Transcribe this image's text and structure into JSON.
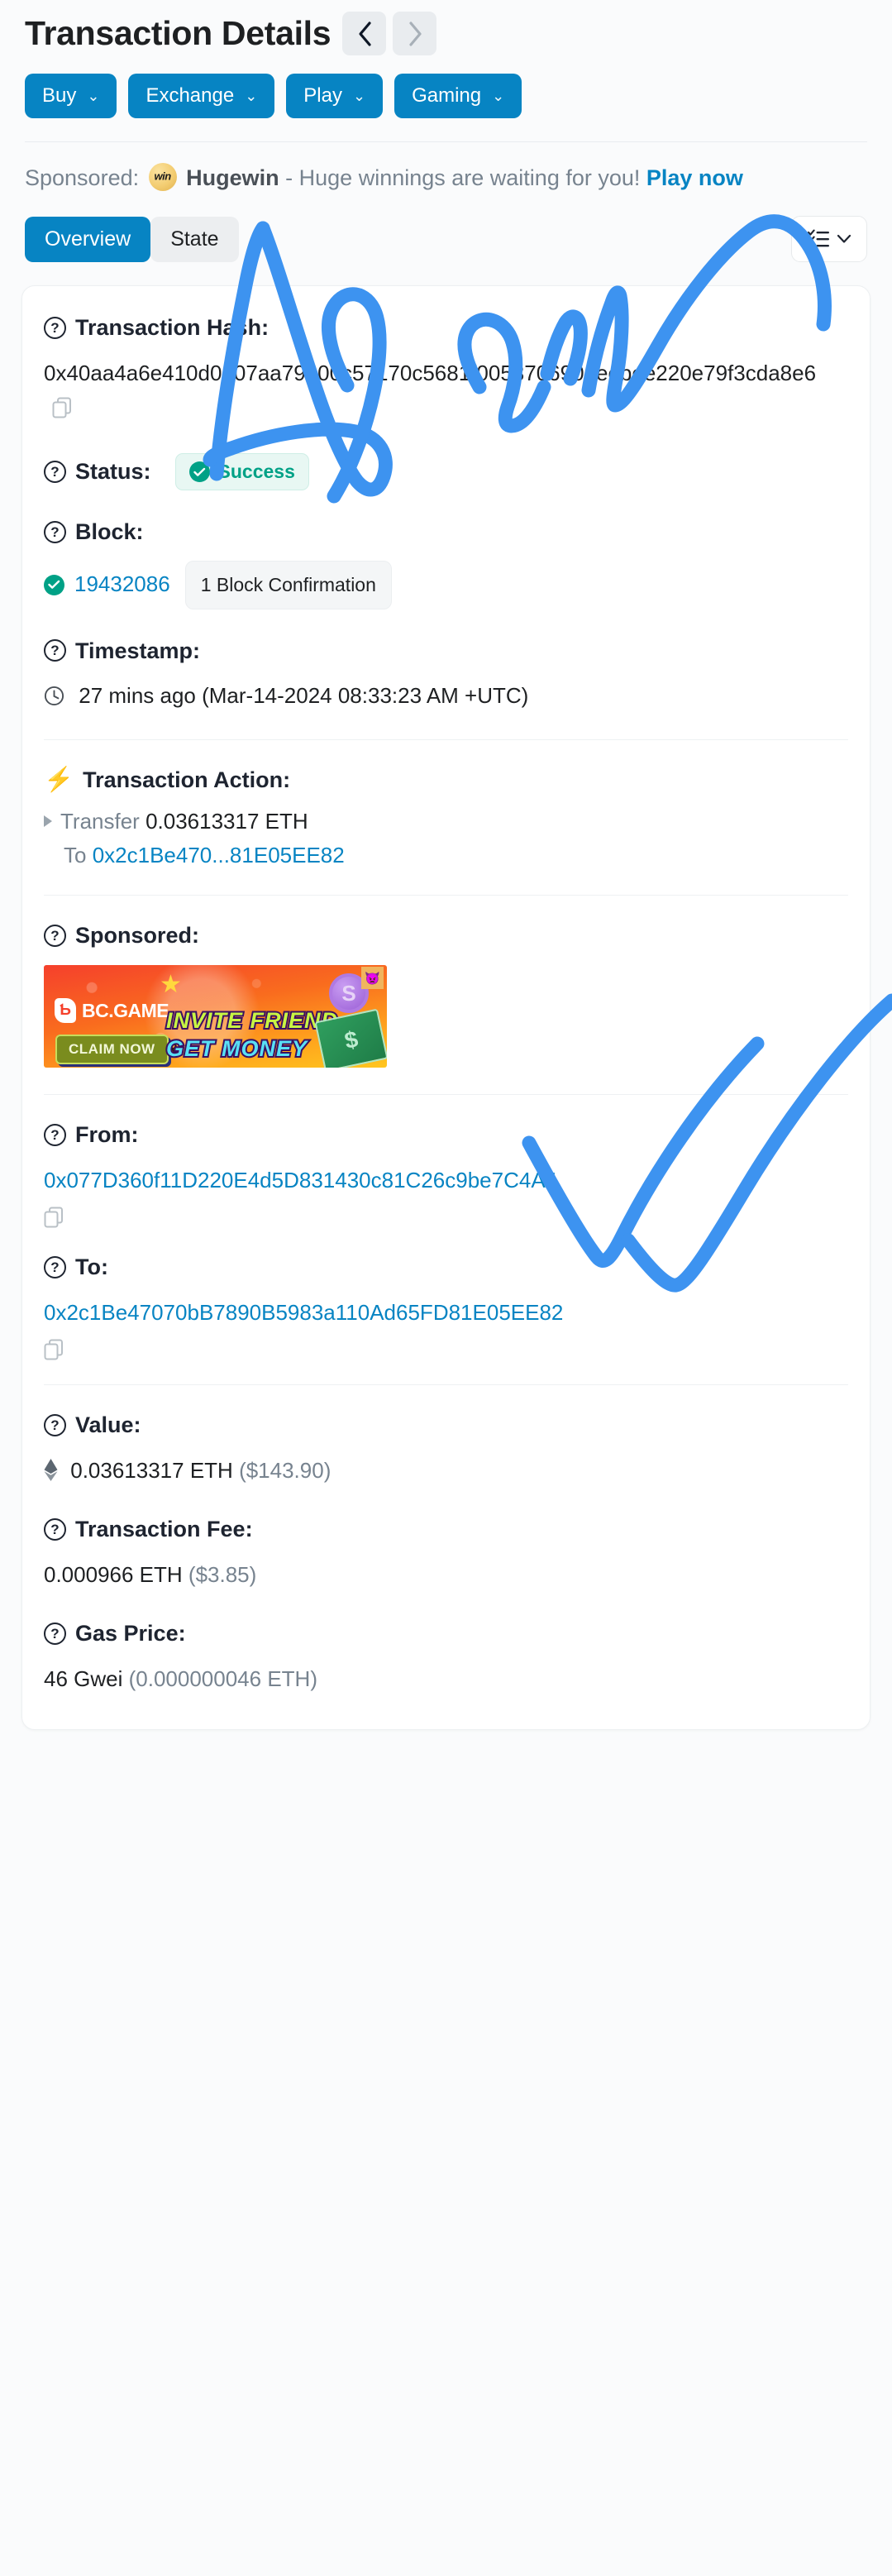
{
  "header": {
    "title": "Transaction Details",
    "prev_label": "‹",
    "next_label": "›",
    "quick_buttons": [
      {
        "label": "Buy",
        "chevron": "⌄"
      },
      {
        "label": "Exchange",
        "chevron": "⌄"
      },
      {
        "label": "Play",
        "chevron": "⌄"
      },
      {
        "label": "Gaming",
        "chevron": "⌄"
      }
    ]
  },
  "sponsor_bar": {
    "prefix": "Sponsored:",
    "brand": "Hugewin",
    "logo_text": "win",
    "body": "- Huge winnings are waiting for you!",
    "cta": "Play now"
  },
  "tabs": {
    "items": [
      {
        "label": "Overview",
        "active": true
      },
      {
        "label": "State",
        "active": false
      }
    ],
    "list_toggle_chevron": "⌄"
  },
  "details": {
    "txn_hash": {
      "label": "Transaction Hash:",
      "value": "0x40aa4a6e410d0607aa79a00c57170c5681f005370690aeebee220e79f3cda8e6",
      "copy_icon": "copy-icon"
    },
    "status": {
      "label": "Status:",
      "badge": "Success",
      "badge_color": "#00a186",
      "badge_bg": "#e8f7f3"
    },
    "block": {
      "label": "Block:",
      "number": "19432086",
      "confirmation": "1 Block Confirmation",
      "link_color": "#0784c3"
    },
    "timestamp": {
      "label": "Timestamp:",
      "value": "27 mins ago (Mar-14-2024 08:33:23 AM +UTC)"
    },
    "transaction_action": {
      "label": "Transaction Action:",
      "verb": "Transfer",
      "amount": "0.03613317 ETH",
      "to_word": "To",
      "to_address_short": "0x2c1Be470...81E05EE82"
    },
    "sponsored": {
      "label": "Sponsored:",
      "banner": {
        "brand": "BC.GAME",
        "logo_glyph": "Ƅ",
        "claim": "CLAIM NOW",
        "line1": "INVITE FRIEND",
        "line2": "GET MONEY",
        "amp": "&",
        "coin_glyph": "S",
        "star1": "★",
        "star2": "★",
        "ghost": "👿"
      }
    },
    "from": {
      "label": "From:",
      "address": "0x077D360f11D220E4d5D831430c81C26c9be7C4A4",
      "copy_icon": "copy-icon"
    },
    "to": {
      "label": "To:",
      "address": "0x2c1Be47070bB7890B5983a110Ad65FD81E05EE82",
      "copy_icon": "copy-icon"
    },
    "value": {
      "label": "Value:",
      "eth": "0.03613317 ETH",
      "usd": "($143.90)"
    },
    "txn_fee": {
      "label": "Transaction Fee:",
      "eth": "0.000966 ETH",
      "usd": "($3.85)"
    },
    "gas_price": {
      "label": "Gas Price:",
      "gwei": "46 Gwei",
      "eth": "(0.000000046 ETH)"
    }
  },
  "annotation": {
    "word": "Again",
    "mark": "double-check",
    "color": "#3d93f0"
  }
}
